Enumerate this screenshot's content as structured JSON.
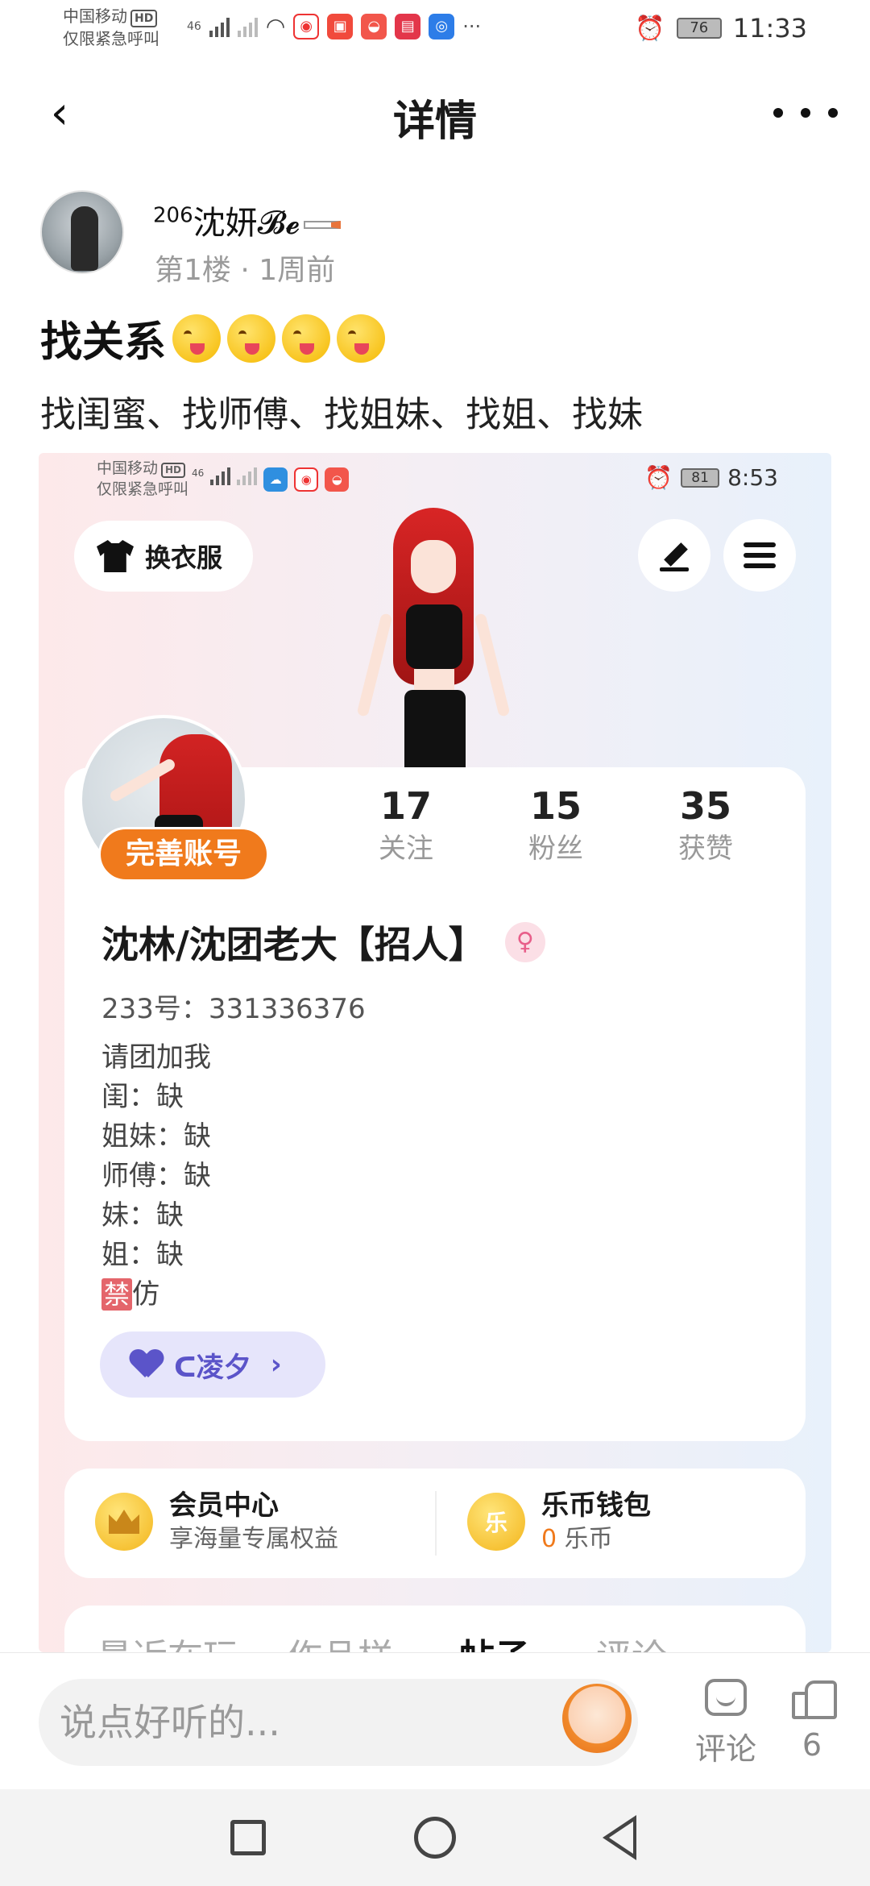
{
  "status_bar": {
    "carrier_line1": "中国移动",
    "hd": "HD",
    "carrier_line2": "仅限紧急呼叫",
    "network": "46",
    "more": "···",
    "battery": "76",
    "time": "11:33"
  },
  "nav": {
    "back_icon": "chevron-left-icon",
    "title": "详情",
    "more_icon": "more-horizontal-icon"
  },
  "post": {
    "author_sup": "206",
    "author_name": "沈妍𝓑𝓮",
    "floor": "第1楼",
    "sep": "·",
    "time_ago": "1周前",
    "title": "找关系",
    "body": "找闺蜜、找师傅、找姐妹、找姐、找妹"
  },
  "screenshot": {
    "status": {
      "carrier_line1": "中国移动",
      "hd": "HD",
      "carrier_line2": "仅限紧急呼叫",
      "network": "46",
      "battery": "81",
      "time": "8:53"
    },
    "wardrobe_label": "换衣服",
    "complete_account_label": "完善账号",
    "stats": [
      {
        "value": "17",
        "label": "关注"
      },
      {
        "value": "15",
        "label": "粉丝"
      },
      {
        "value": "35",
        "label": "获赞"
      }
    ],
    "nickname": "沈林/沈团老大【招人】",
    "gender_symbol": "♀",
    "uid": "233号：331336376",
    "bio": [
      "请团加我",
      "闺：缺",
      "姐妹：缺",
      "师傅：缺",
      "妹：缺",
      "姐：缺"
    ],
    "bio_ban_tag": "禁",
    "bio_ban_text": "仿",
    "group_chip_label": "ᑕ凌夕",
    "group_chip_arrow": "›",
    "vip": {
      "title": "会员中心",
      "subtitle": "享海量专属权益"
    },
    "wallet": {
      "coin_glyph": "乐",
      "title": "乐币钱包",
      "amount": "0",
      "unit": "乐币"
    },
    "tabs": [
      "最近在玩",
      "作品样",
      "帖子",
      "评论"
    ],
    "active_tab": "帖子"
  },
  "comment_bar": {
    "placeholder": "说点好听的...",
    "comment_label": "评论",
    "like_count": "6"
  },
  "colors": {
    "accent_orange": "#f07a1c",
    "chip_purple": "#5b54c9",
    "gender_pink": "#e85f8a"
  }
}
